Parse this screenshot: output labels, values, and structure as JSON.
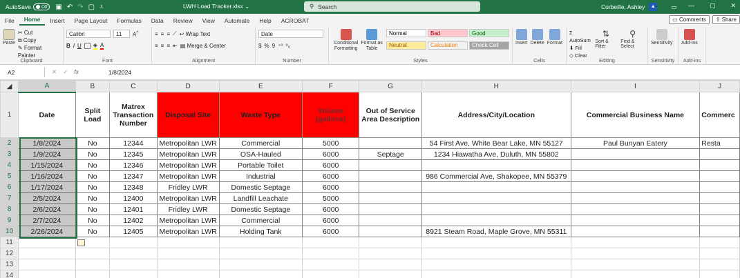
{
  "titlebar": {
    "autosave_label": "AutoSave",
    "autosave_state": "Off",
    "filename": "LWH Load Tracker.xlsx",
    "search_placeholder": "Search",
    "user_name": "Corbeille, Ashley"
  },
  "menu": {
    "tabs": [
      "File",
      "Home",
      "Insert",
      "Page Layout",
      "Formulas",
      "Data",
      "Review",
      "View",
      "Automate",
      "Help",
      "ACROBAT"
    ],
    "active": "Home",
    "comments_label": "Comments",
    "share_label": "Share"
  },
  "ribbon": {
    "clipboard": {
      "label": "Clipboard",
      "paste": "Paste",
      "cut": "Cut",
      "copy": "Copy",
      "format_painter": "Format Painter"
    },
    "font": {
      "label": "Font",
      "name": "Calibri",
      "size": "11"
    },
    "alignment": {
      "label": "Alignment",
      "wrap": "Wrap Text",
      "merge": "Merge & Center"
    },
    "number": {
      "label": "Number",
      "format": "Date",
      "currency": "$",
      "percent": "%",
      "comma": "9"
    },
    "styles": {
      "label": "Styles",
      "conditional": "Conditional Formatting",
      "format_as_table": "Format as Table",
      "cells": [
        {
          "name": "Normal",
          "bg": "#ffffff",
          "fg": "#000000"
        },
        {
          "name": "Bad",
          "bg": "#ffc7ce",
          "fg": "#9c0006"
        },
        {
          "name": "Good",
          "bg": "#c6efce",
          "fg": "#006100"
        },
        {
          "name": "Neutral",
          "bg": "#ffeb9c",
          "fg": "#9c5700"
        },
        {
          "name": "Calculation",
          "bg": "#f2f2f2",
          "fg": "#fa7d00"
        },
        {
          "name": "Check Cell",
          "bg": "#a5a5a5",
          "fg": "#ffffff"
        }
      ]
    },
    "cells": {
      "label": "Cells",
      "insert": "Insert",
      "delete": "Delete",
      "format": "Format"
    },
    "editing": {
      "label": "Editing",
      "autosum": "AutoSum",
      "fill": "Fill",
      "clear": "Clear",
      "sort": "Sort & Filter",
      "find": "Find & Select"
    },
    "sensitivity": {
      "label": "Sensitivity",
      "btn": "Sensitivity"
    },
    "addins": {
      "label": "Add-ins",
      "btn": "Add-ins"
    }
  },
  "formula_bar": {
    "cell_ref": "A2",
    "fx": "fx",
    "value": "1/8/2024"
  },
  "sheet": {
    "columns": [
      "A",
      "B",
      "C",
      "D",
      "E",
      "F",
      "G",
      "H",
      "I",
      "J"
    ],
    "row_numbers": [
      "1",
      "2",
      "3",
      "4",
      "5",
      "6",
      "7",
      "8",
      "9",
      "10",
      "11",
      "12",
      "13",
      "14"
    ],
    "headers": [
      "Date",
      "Split Load",
      "Matrex Transaction Number",
      "Disposal Site",
      "Waste Type",
      "Volume (gallons)",
      "Out of Service Area Description",
      "Address/City/Location",
      "Commercial Business Name",
      "Commerc"
    ],
    "rows": [
      [
        "1/8/2024",
        "No",
        "12344",
        "Metropolitan LWR",
        "Commercial",
        "5000",
        "",
        "54 First Ave, White Bear Lake, MN 55127",
        "Paul Bunyan Eatery",
        "Resta"
      ],
      [
        "1/9/2024",
        "No",
        "12345",
        "Metropolitan LWR",
        "OSA-Hauled",
        "6000",
        "Septage",
        "1234 Hiawatha Ave, Duluth, MN 55802",
        "",
        ""
      ],
      [
        "1/15/2024",
        "No",
        "12346",
        "Metropolitan LWR",
        "Portable Toilet",
        "6000",
        "",
        "",
        "",
        ""
      ],
      [
        "1/16/2024",
        "No",
        "12347",
        "Metropolitan LWR",
        "Industrial",
        "6000",
        "",
        "986 Commercial Ave, Shakopee, MN 55379",
        "",
        ""
      ],
      [
        "1/17/2024",
        "No",
        "12348",
        "Fridley LWR",
        "Domestic Septage",
        "6000",
        "",
        "",
        "",
        ""
      ],
      [
        "2/5/2024",
        "No",
        "12400",
        "Metropolitan LWR",
        "Landfill Leachate",
        "5000",
        "",
        "",
        "",
        ""
      ],
      [
        "2/6/2024",
        "No",
        "12401",
        "Fridley LWR",
        "Domestic Septage",
        "6000",
        "",
        "",
        "",
        ""
      ],
      [
        "2/7/2024",
        "No",
        "12402",
        "Metropolitan LWR",
        "Commercial",
        "6000",
        "",
        "",
        "",
        ""
      ],
      [
        "2/26/2024",
        "No",
        "12405",
        "Metropolitan LWR",
        "Holding Tank",
        "6000",
        "",
        "8921 Steam Road, Maple Grove, MN 55311",
        "",
        ""
      ]
    ]
  }
}
